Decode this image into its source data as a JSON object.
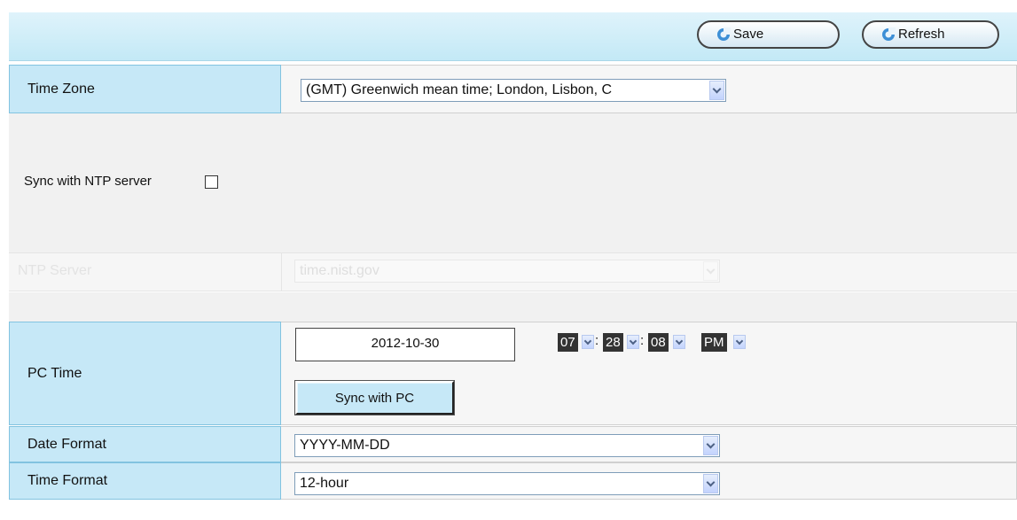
{
  "toolbar": {
    "save_label": "Save",
    "refresh_label": "Refresh"
  },
  "time_zone": {
    "label": "Time Zone",
    "value": "(GMT) Greenwich mean time; London, Lisbon, C"
  },
  "ntp_sync": {
    "label": "Sync with NTP server",
    "checked": false
  },
  "ntp_server": {
    "label": "NTP Server",
    "value": "time.nist.gov",
    "disabled": true
  },
  "pc_time": {
    "label": "PC Time",
    "date": "2012-10-30",
    "hour": "07",
    "minute": "28",
    "second": "08",
    "ampm": "PM",
    "separator": ":",
    "sync_label": "Sync with PC"
  },
  "date_format": {
    "label": "Date Format",
    "value": "YYYY-MM-DD"
  },
  "time_format": {
    "label": "Time Format",
    "value": "12-hour"
  },
  "colors": {
    "label_bg": "#c6e8f7",
    "toolbar_bg": "#c3e9f6",
    "value_bg": "#f6f6f6"
  }
}
